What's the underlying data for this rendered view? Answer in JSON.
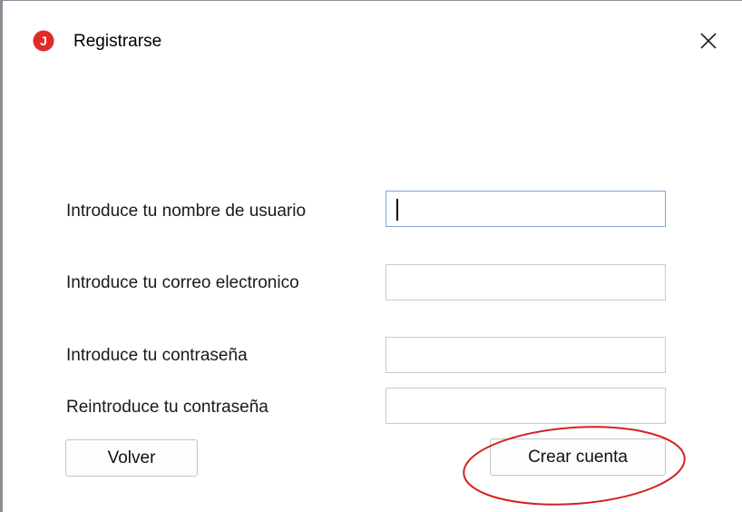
{
  "window": {
    "title": "Registrarse",
    "app_icon_letter": "J",
    "accent_color": "#e02b2b"
  },
  "form": {
    "username_label": "Introduce tu nombre de usuario",
    "username_value": "",
    "email_label": "Introduce tu correo electronico",
    "email_value": "",
    "password_label": "Introduce tu contraseña",
    "password_value": "",
    "confirm_password_label": "Reintroduce tu contraseña",
    "confirm_password_value": ""
  },
  "buttons": {
    "back_label": "Volver",
    "create_label": "Crear cuenta"
  },
  "annotation": {
    "shape": "ellipse",
    "color": "#d42020",
    "target": "create-account-button"
  }
}
